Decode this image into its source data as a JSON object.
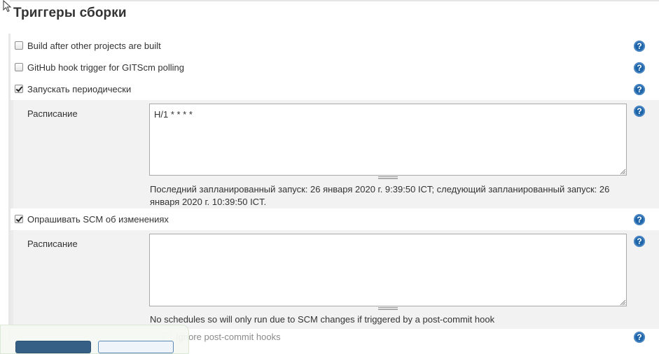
{
  "section": {
    "title": "Триггеры сборки"
  },
  "triggers": {
    "build_after": {
      "label": "Build after other projects are built",
      "checked": false
    },
    "github_hook": {
      "label": "GitHub hook trigger for GITScm polling",
      "checked": false
    },
    "periodic": {
      "label": "Запускать периодически",
      "checked": true,
      "schedule_label": "Расписание",
      "schedule_value": "H/1 * * * *",
      "hint": "Последний запланированный запуск: 26 января 2020 г. 9:39:50 ICT; следующий запланированный запуск: 26 января 2020 г. 10:39:50 ICT."
    },
    "poll_scm": {
      "label": "Опрашивать SCM об изменениях",
      "checked": true,
      "schedule_label": "Расписание",
      "schedule_value": "",
      "hint": "No schedules so will only run due to SCM changes if triggered by a post-commit hook",
      "ignore_hooks_label": "Ignore post-commit hooks"
    }
  },
  "help": {
    "glyph": "?"
  },
  "colors": {
    "help_icon": "#1d64a8",
    "sub_block_bg": "#f2f2f2",
    "primary_button": "#355f85"
  },
  "icons": {
    "cursor": "mouse-pointer-icon",
    "help": "question-circle-icon"
  }
}
